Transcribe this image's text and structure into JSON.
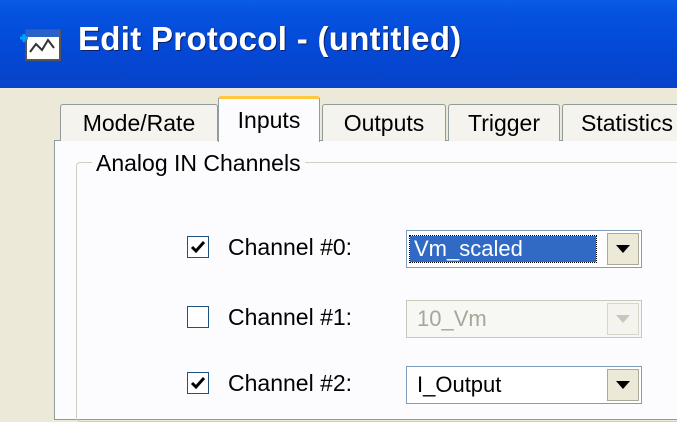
{
  "window": {
    "title": "Edit Protocol - (untitled)",
    "icon": "protocol-icon"
  },
  "tabs": [
    {
      "label": "Mode/Rate",
      "active": false
    },
    {
      "label": "Inputs",
      "active": true
    },
    {
      "label": "Outputs",
      "active": false
    },
    {
      "label": "Trigger",
      "active": false
    },
    {
      "label": "Statistics",
      "active": false
    }
  ],
  "group": {
    "label": "Analog IN Channels"
  },
  "channels": [
    {
      "label": "Channel #0:",
      "checked": true,
      "value": "Vm_scaled",
      "enabled": true,
      "selected": true
    },
    {
      "label": "Channel #1:",
      "checked": false,
      "value": "10_Vm",
      "enabled": false,
      "selected": false
    },
    {
      "label": "Channel #2:",
      "checked": true,
      "value": "I_Output",
      "enabled": true,
      "selected": false
    }
  ],
  "colors": {
    "titlebar": "#0553e0",
    "selection": "#316ac5",
    "tab_highlight": "#ffc83c"
  }
}
